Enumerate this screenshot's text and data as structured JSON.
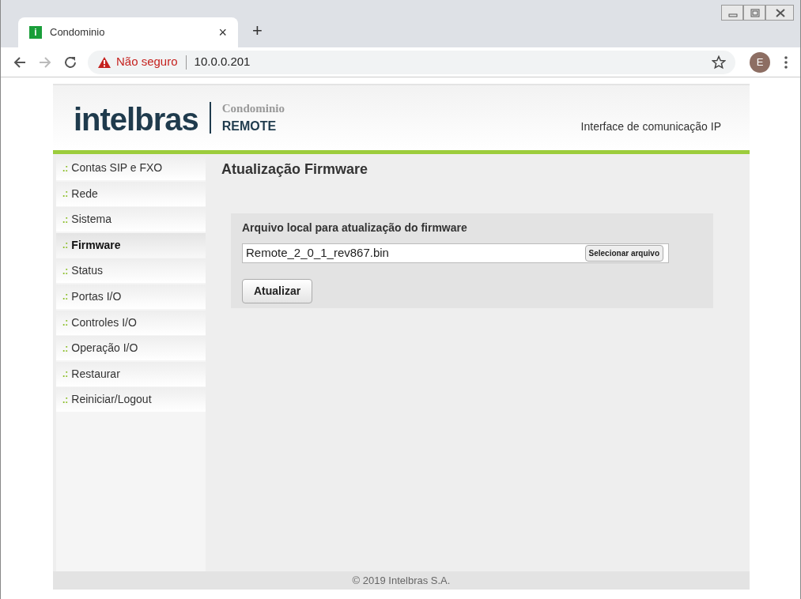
{
  "browser": {
    "tab": {
      "favicon": "i",
      "title": "Condominio",
      "close": "×"
    },
    "new_tab": "+",
    "security": "Não seguro",
    "url": "10.0.0.201",
    "avatar": "E"
  },
  "header": {
    "logo": "intelbras",
    "product_top": "Condominio",
    "product_bottom": "REMOTE",
    "tagline": "Interface de comunicação IP"
  },
  "sidebar": {
    "items": [
      {
        "marker": ".:",
        "label": "Contas SIP e FXO",
        "selected": false
      },
      {
        "marker": ".:",
        "label": "Rede",
        "selected": false
      },
      {
        "marker": ".:",
        "label": "Sistema",
        "selected": false
      },
      {
        "marker": ".:",
        "label": "Firmware",
        "selected": true
      },
      {
        "marker": ".:",
        "label": "Status",
        "selected": false
      },
      {
        "marker": ".:",
        "label": "Portas I/O",
        "selected": false
      },
      {
        "marker": ".:",
        "label": "Controles I/O",
        "selected": false
      },
      {
        "marker": ".:",
        "label": "Operação I/O",
        "selected": false
      },
      {
        "marker": ".:",
        "label": "Restaurar",
        "selected": false
      },
      {
        "marker": ".:",
        "label": "Reiniciar/Logout",
        "selected": false
      }
    ]
  },
  "main": {
    "title": "Atualização Firmware",
    "panel": {
      "label": "Arquivo local para atualização do firmware",
      "file_value": "Remote_2_0_1_rev867.bin",
      "choose_button": "Selecionar arquivo",
      "submit_button": "Atualizar"
    }
  },
  "footer": "© 2019 Intelbras S.A."
}
